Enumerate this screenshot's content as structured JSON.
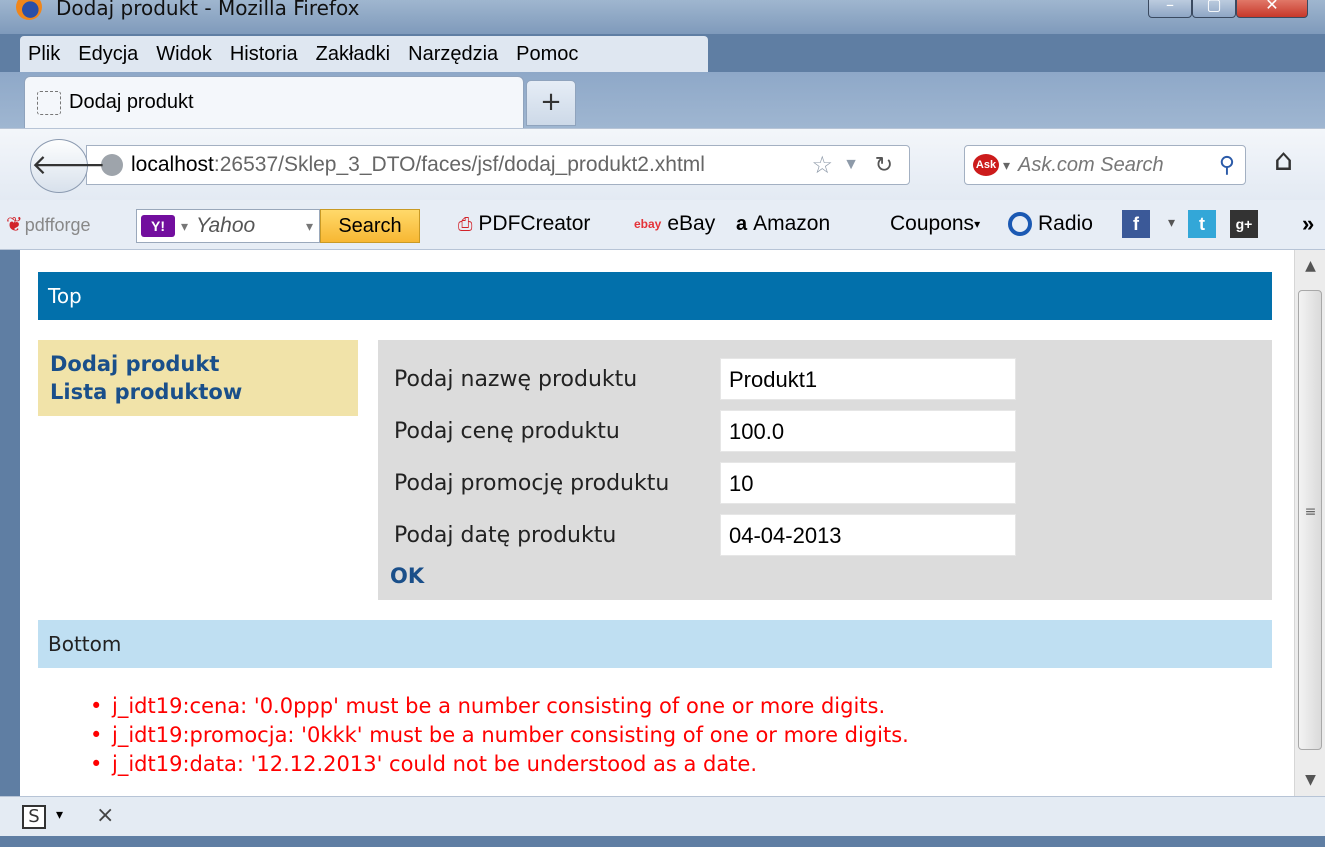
{
  "window": {
    "title": "Dodaj produkt - Mozilla Firefox"
  },
  "menu": [
    "Plik",
    "Edycja",
    "Widok",
    "Historia",
    "Zakładki",
    "Narzędzia",
    "Pomoc"
  ],
  "tab": {
    "title": "Dodaj produkt",
    "new_tab_label": "+"
  },
  "nav": {
    "url_host": "localhost",
    "url_rest": ":26537/Sklep_3_DTO/faces/jsf/dodaj_produkt2.xhtml",
    "search_placeholder": "Ask.com Search",
    "ask_icon": "Ask"
  },
  "bookmarks": {
    "pdfforge": "pdfforge",
    "yahoo_logo": "Y!",
    "yahoo_placeholder": "Yahoo",
    "search_button": "Search",
    "items": [
      "PDFCreator",
      "eBay",
      "Amazon",
      "Coupons",
      "Radio"
    ],
    "ebay_icon": "ebay",
    "amazon_icon": "a"
  },
  "page": {
    "top": "Top",
    "nav_links": [
      "Dodaj produkt",
      "Lista produktow"
    ],
    "form": {
      "fields": [
        {
          "label": "Podaj nazwę produktu",
          "value": "Produkt1"
        },
        {
          "label": "Podaj cenę produktu",
          "value": "100.0"
        },
        {
          "label": "Podaj promocję produktu",
          "value": "10"
        },
        {
          "label": "Podaj datę produktu",
          "value": "04-04-2013"
        }
      ],
      "submit": "OK"
    },
    "bottom": "Bottom",
    "errors": [
      "j_idt19:cena: '0.0ppp' must be a number consisting of one or more digits.",
      "j_idt19:promocja: '0kkk' must be a number consisting of one or more digits.",
      "j_idt19:data: '12.12.2013' could not be understood as a date."
    ]
  },
  "colors": {
    "top_band": "#0270ab",
    "bottom_band": "#bfdff2",
    "nav_panel": "#f1e3a9",
    "form_panel": "#dcdcdc",
    "error_text": "#ff0000",
    "link_text": "#1a4f8a"
  },
  "icons": {
    "firefox": "firefox-logo-icon",
    "back": "back-arrow-icon",
    "reload": "reload-icon",
    "home": "home-icon",
    "star": "bookmark-star-icon",
    "search": "magnifier-icon"
  }
}
